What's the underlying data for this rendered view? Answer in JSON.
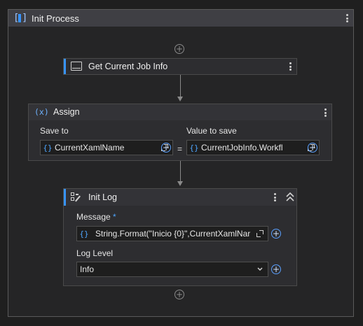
{
  "sequence": {
    "title": "Init Process",
    "icon": "sequence-icon"
  },
  "activities": {
    "get_job_info": {
      "title": "Get Current Job Info",
      "icon": "window-icon"
    },
    "assign": {
      "title": "Assign",
      "icon": "assign-icon",
      "icon_text": "(x)",
      "save_to_label": "Save to",
      "save_to_value": "CurrentXamlName",
      "equals": "=",
      "value_label": "Value to save",
      "value_value": "CurrentJobInfo.Workfl"
    },
    "init_log": {
      "title": "Init Log",
      "icon": "log-icon",
      "message_label": "Message",
      "required_marker": "*",
      "message_value": "String.Format(\"Inicio {0}\",CurrentXamlNar",
      "log_level_label": "Log Level",
      "log_level_value": "Info"
    }
  },
  "symbols": {
    "brace": "{}",
    "plus": "+"
  },
  "colors": {
    "accent": "#3794ff",
    "background": "#1f1f1f",
    "activity": "#2d2d30"
  }
}
